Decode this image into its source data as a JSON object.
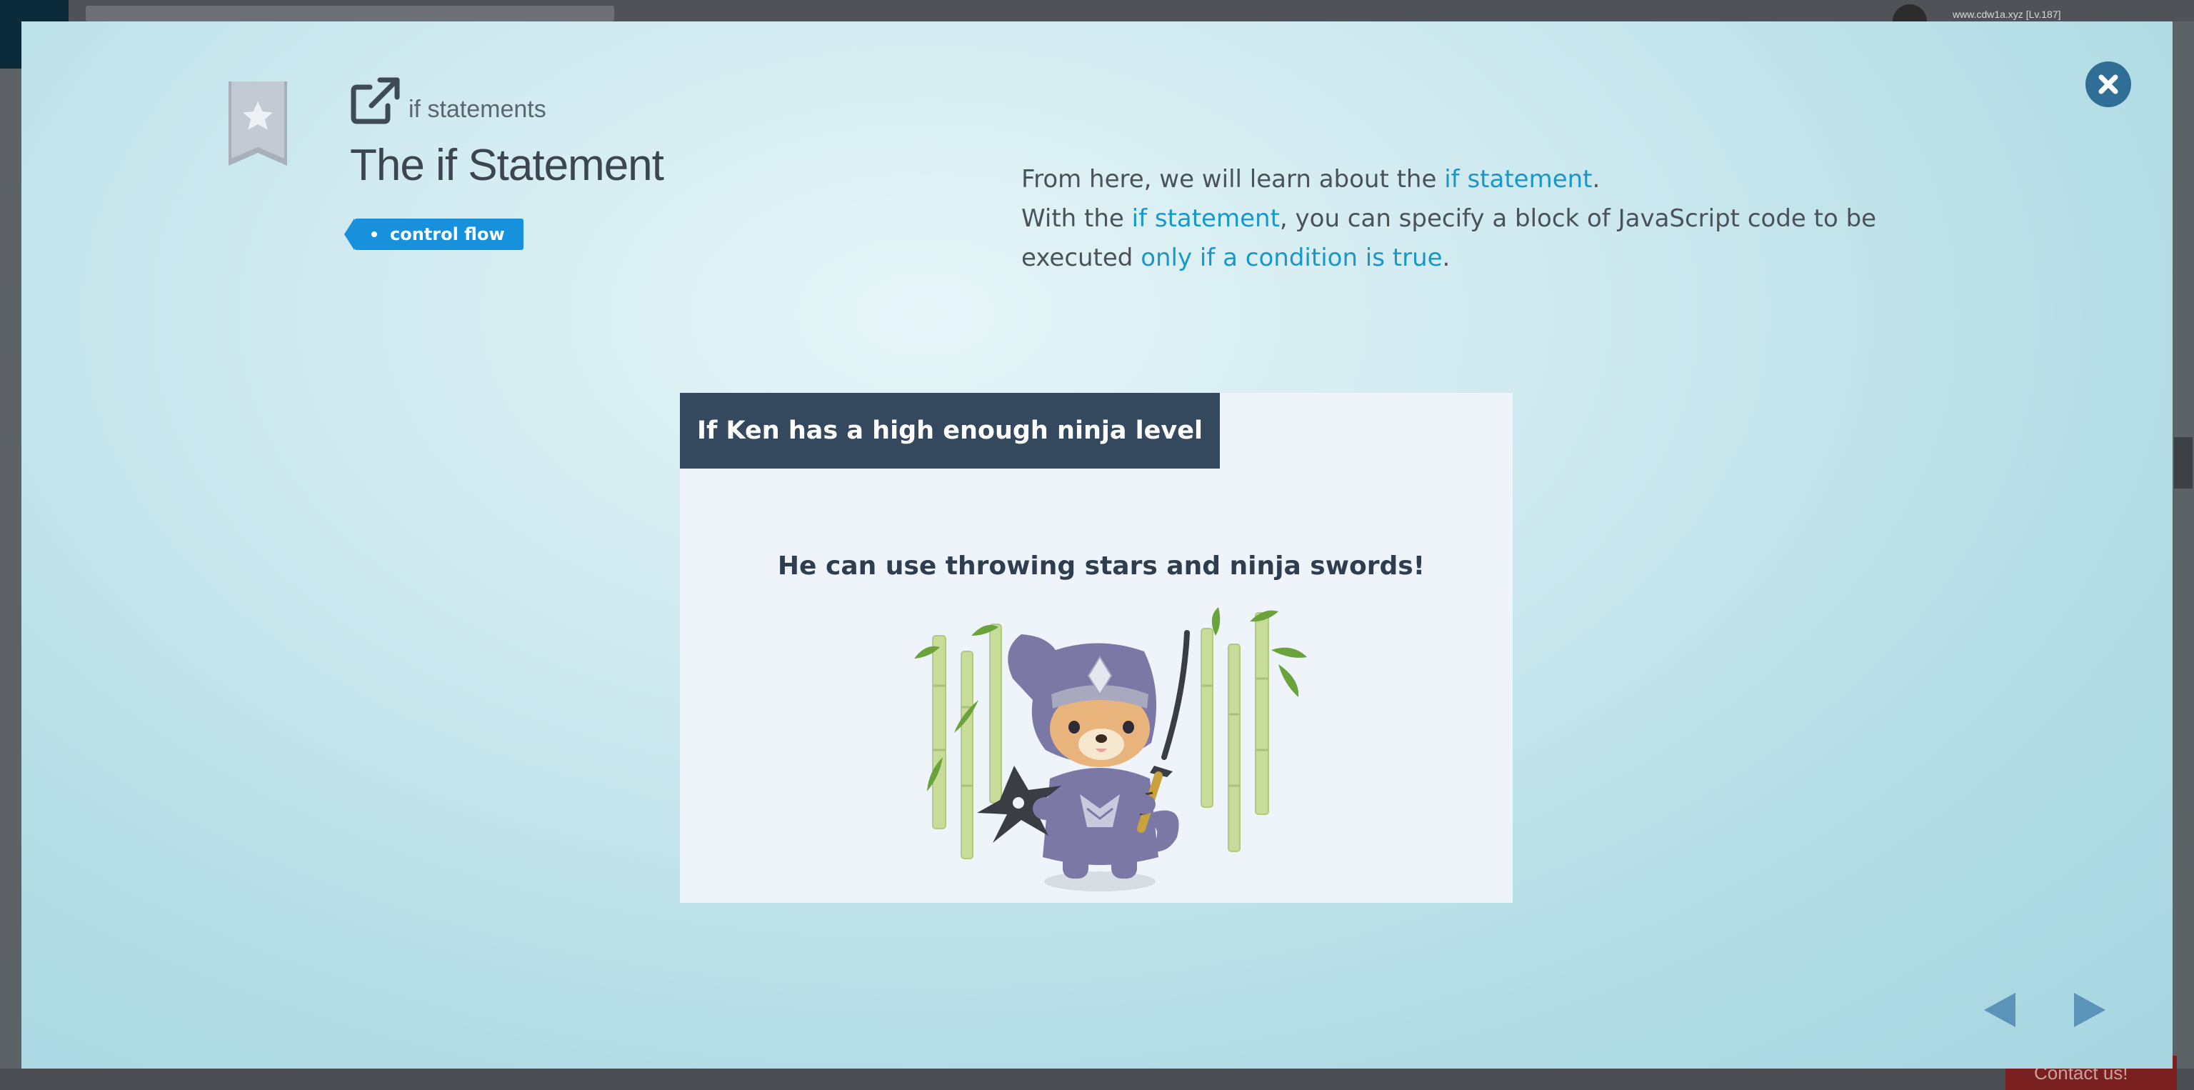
{
  "background": {
    "user_text": "www.cdw1a.xyz [Lv.187]",
    "contact_label": "Contact us!"
  },
  "modal": {
    "topic": "if statements",
    "title": "The if Statement",
    "tag": "control flow",
    "description": {
      "line1_pre": "From here, we will learn about the ",
      "line1_link": "if statement",
      "line1_post": ".",
      "line2_pre": "With the ",
      "line2_link": "if statement",
      "line2_post": ", you can specify a block of JavaScript code to be",
      "line3_pre": "executed ",
      "line3_link": "only if a condition is true",
      "line3_post": "."
    },
    "slide": {
      "banner": "If Ken has a high enough ninja level",
      "caption": "He can use throwing stars and ninja swords!"
    }
  },
  "icons": {
    "close": "close-icon",
    "bookmark": "bookmark-star-icon",
    "external_link": "external-link-icon",
    "prev": "arrow-left-icon",
    "next": "arrow-right-icon"
  },
  "colors": {
    "accent": "#1791dc",
    "link": "#1998c8",
    "banner": "#35495e",
    "close": "#2f6f95",
    "nav_arrow": "#5c93b9"
  }
}
